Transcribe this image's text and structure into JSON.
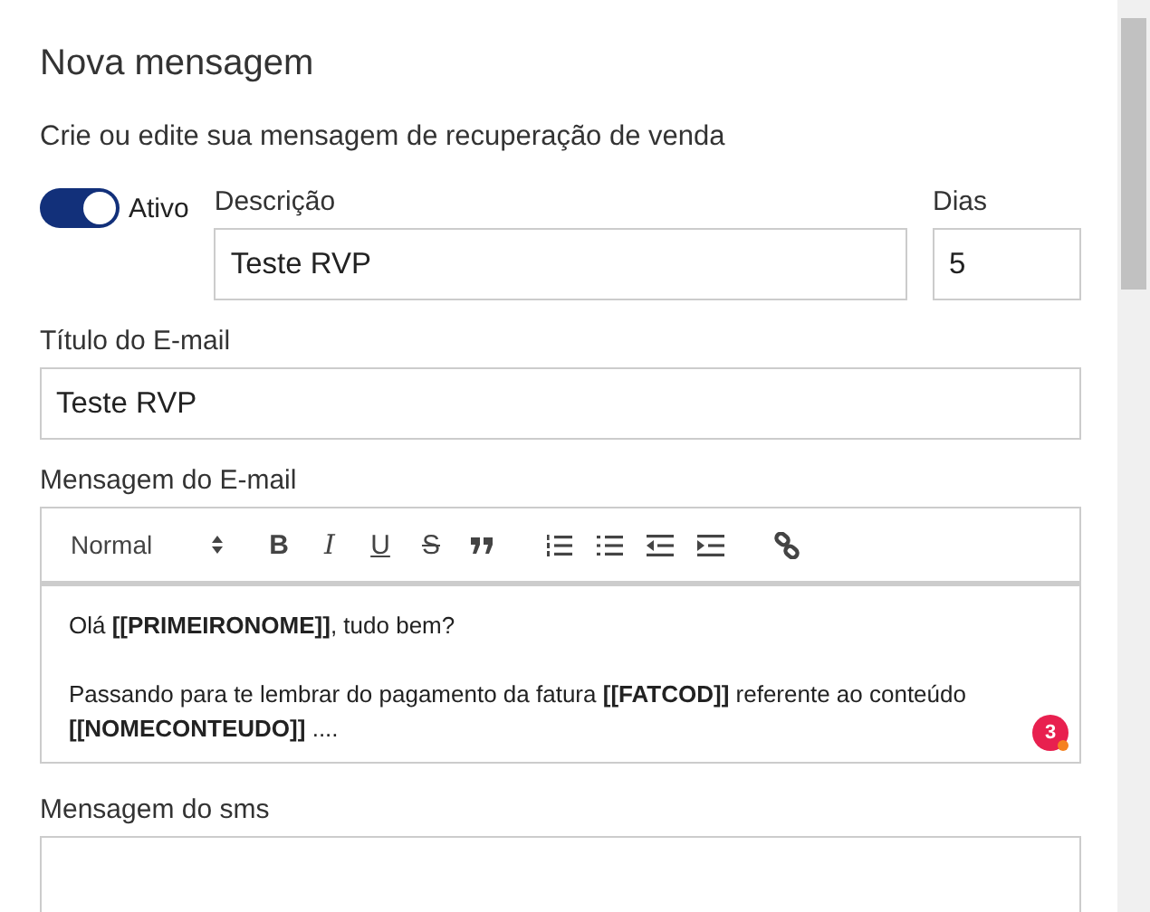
{
  "title": "Nova mensagem",
  "subtitle": "Crie ou edite sua mensagem de recuperação de venda",
  "active_toggle": {
    "label": "Ativo",
    "on": true
  },
  "description": {
    "label": "Descrição",
    "value": "Teste RVP"
  },
  "days": {
    "label": "Dias",
    "value": "5"
  },
  "email_title": {
    "label": "Título do E-mail",
    "value": "Teste RVP"
  },
  "email_message": {
    "label": "Mensagem do E-mail",
    "toolbar": [
      {
        "kind": "select",
        "label": "Normal"
      },
      {
        "kind": "bold",
        "label": "B"
      },
      {
        "kind": "italic",
        "label": "I"
      },
      {
        "kind": "underline",
        "label": "U"
      },
      {
        "kind": "strike",
        "label": "S"
      },
      {
        "kind": "quote"
      },
      {
        "kind": "ordered-list"
      },
      {
        "kind": "bullet-list"
      },
      {
        "kind": "outdent"
      },
      {
        "kind": "indent"
      },
      {
        "kind": "link"
      }
    ],
    "paragraphs": [
      "Olá **[[PRIMEIRONOME]]**, tudo bem?",
      "Passando para te lembrar do pagamento da fatura **[[FATCOD]]** referente ao conteúdo **[[NOMECONTEUDO]]** ...."
    ],
    "badge": "3"
  },
  "sms_message": {
    "label": "Mensagem do sms"
  }
}
